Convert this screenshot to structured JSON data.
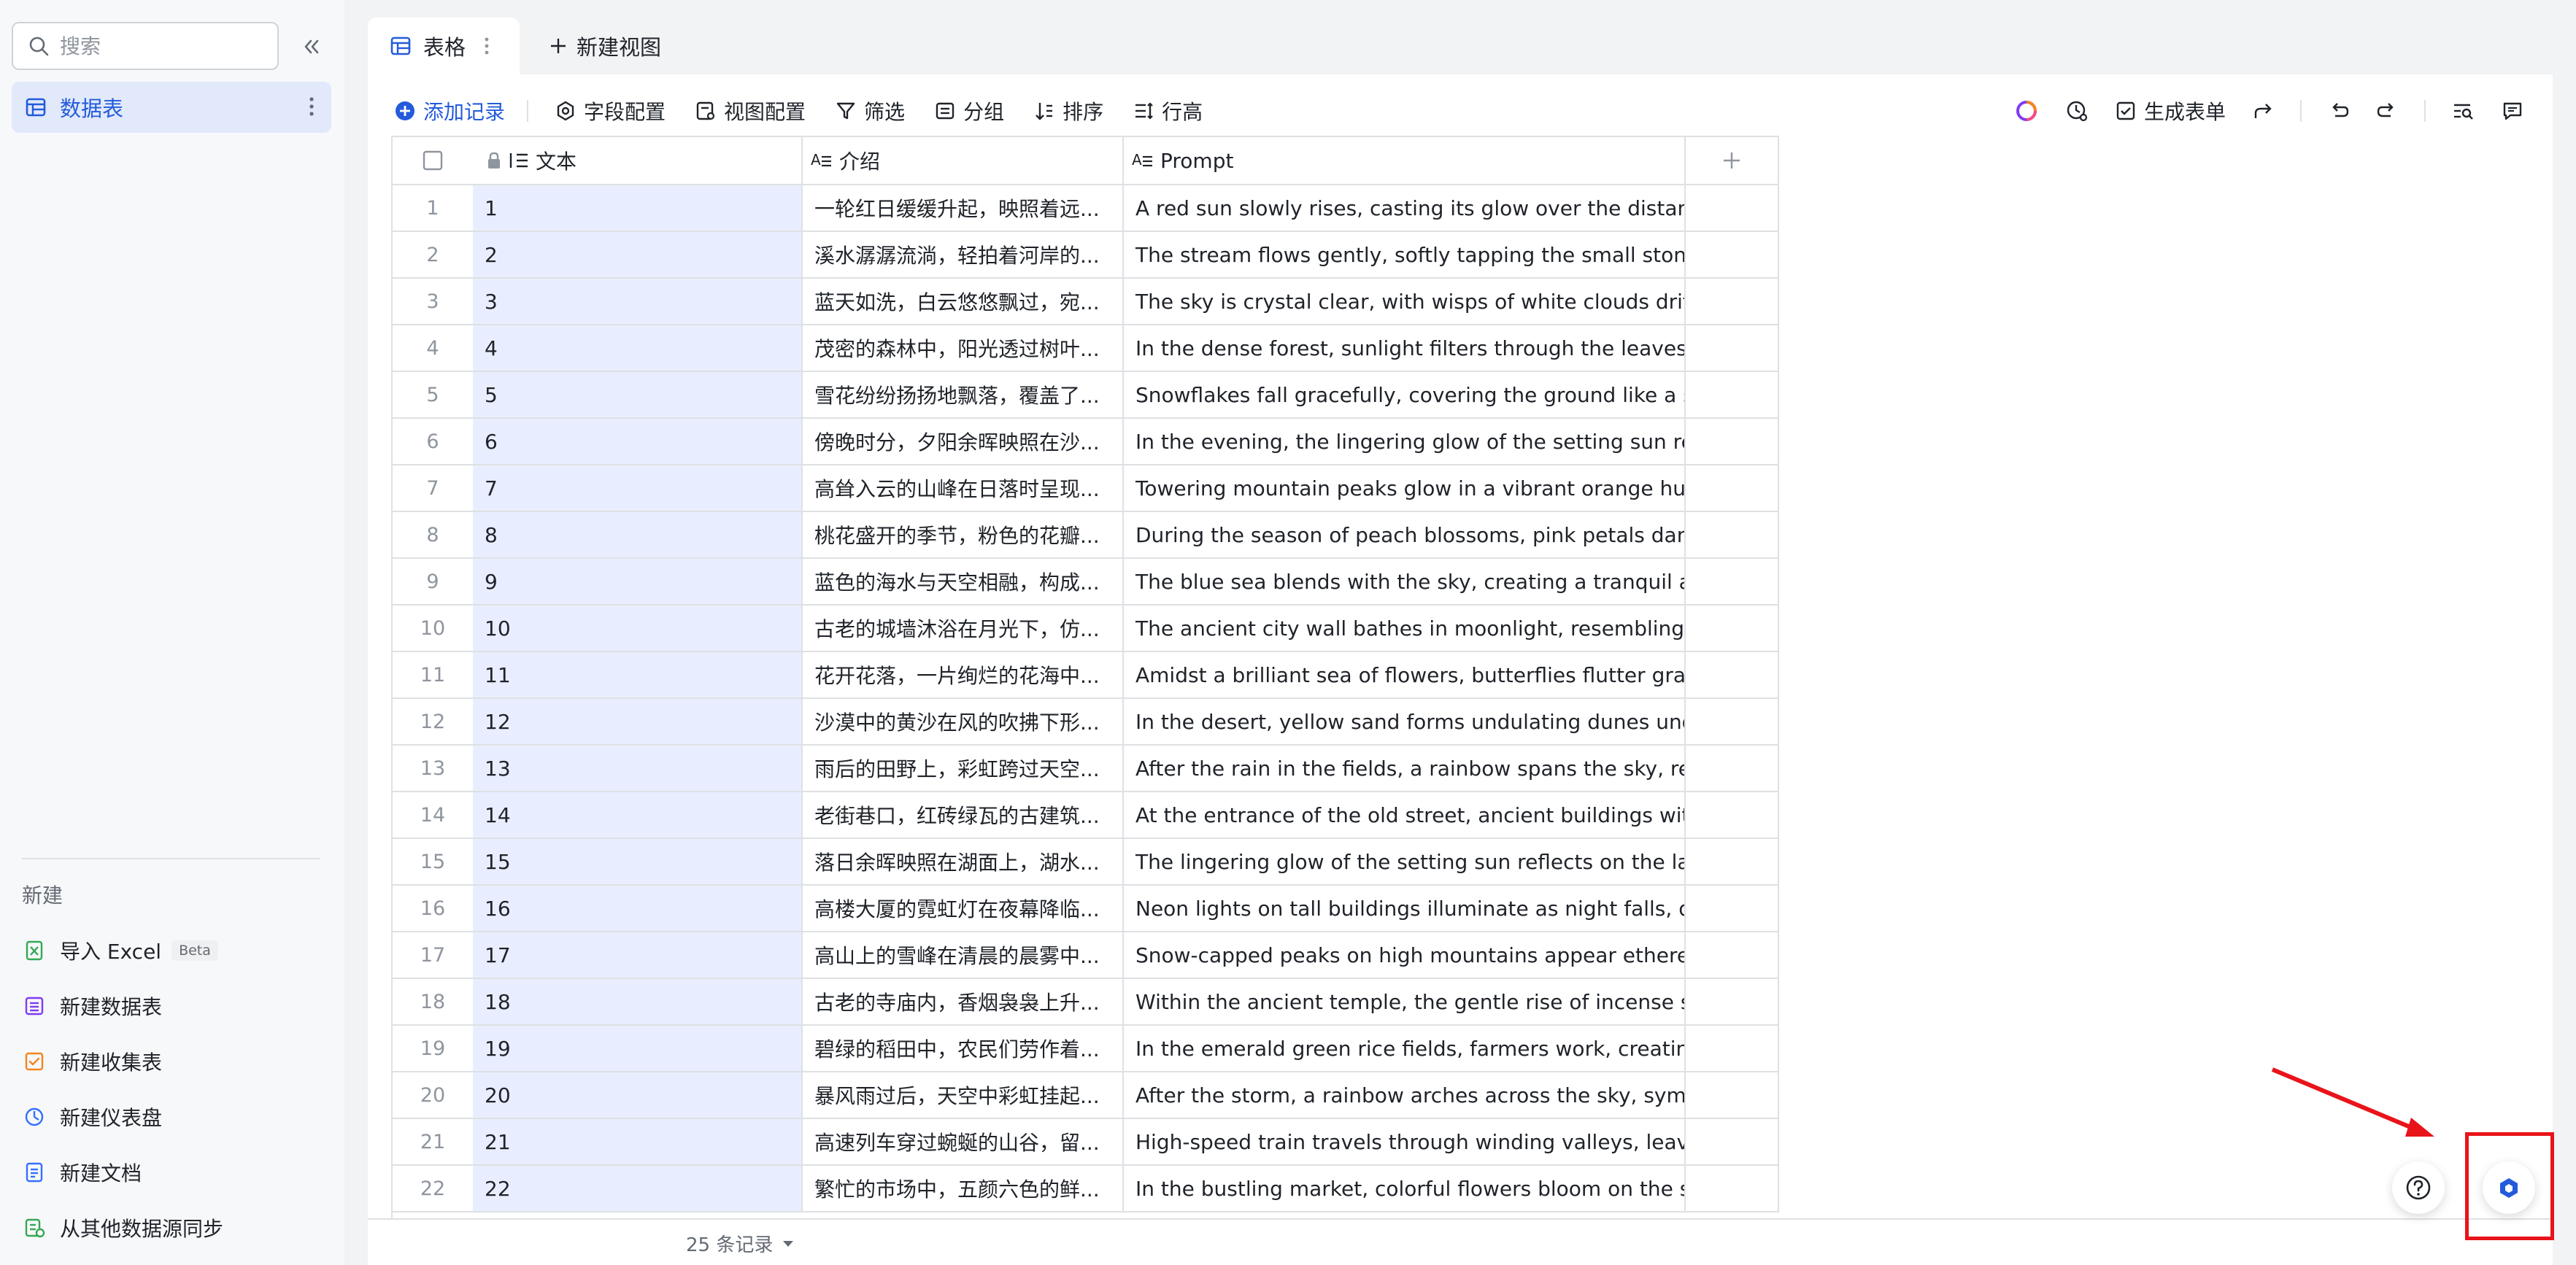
{
  "sidebar": {
    "search_placeholder": "搜索",
    "active_item": "数据表",
    "new_section_title": "新建",
    "new_items": [
      {
        "label": "导入 Excel",
        "badge": "Beta"
      },
      {
        "label": "新建数据表"
      },
      {
        "label": "新建收集表"
      },
      {
        "label": "新建仪表盘"
      },
      {
        "label": "新建文档"
      },
      {
        "label": "从其他数据源同步"
      }
    ]
  },
  "tabs": {
    "active_view": "表格",
    "new_view": "新建视图"
  },
  "toolbar": {
    "add_record": "添加记录",
    "field_config": "字段配置",
    "view_config": "视图配置",
    "filter": "筛选",
    "group": "分组",
    "sort": "排序",
    "row_height": "行高",
    "generate_form": "生成表单"
  },
  "table": {
    "columns": [
      "文本",
      "介绍",
      "Prompt"
    ],
    "rows": [
      {
        "n": "1",
        "text": "1",
        "intro": "一轮红日缓缓升起，映照着远...",
        "prompt": "A red sun slowly rises, casting its glow over the distant ..."
      },
      {
        "n": "2",
        "text": "2",
        "intro": "溪水潺潺流淌，轻拍着河岸的...",
        "prompt": "The stream flows gently, softly tapping the small stones..."
      },
      {
        "n": "3",
        "text": "3",
        "intro": "蓝天如洗，白云悠悠飘过，宛...",
        "prompt": "The sky is crystal clear, with wisps of white clouds drifti..."
      },
      {
        "n": "4",
        "text": "4",
        "intro": "茂密的森林中，阳光透过树叶...",
        "prompt": "In the dense forest, sunlight filters through the leaves, ..."
      },
      {
        "n": "5",
        "text": "5",
        "intro": "雪花纷纷扬扬地飘落，覆盖了...",
        "prompt": "Snowflakes fall gracefully, covering the ground like a sil..."
      },
      {
        "n": "6",
        "text": "6",
        "intro": "傍晚时分，夕阳余晖映照在沙...",
        "prompt": "In the evening, the lingering glow of the setting sun refl..."
      },
      {
        "n": "7",
        "text": "7",
        "intro": "高耸入云的山峰在日落时呈现...",
        "prompt": "Towering mountain peaks glow in a vibrant orange hue ..."
      },
      {
        "n": "8",
        "text": "8",
        "intro": "桃花盛开的季节，粉色的花瓣...",
        "prompt": "During the season of peach blossoms, pink petals danc..."
      },
      {
        "n": "9",
        "text": "9",
        "intro": "蓝色的海水与天空相融，构成...",
        "prompt": "The blue sea blends with the sky, creating a tranquil an..."
      },
      {
        "n": "10",
        "text": "10",
        "intro": "古老的城墙沐浴在月光下，仿...",
        "prompt": "The ancient city wall bathes in moonlight, resembling a ..."
      },
      {
        "n": "11",
        "text": "11",
        "intro": "花开花落，一片绚烂的花海中...",
        "prompt": "Amidst a brilliant sea of flowers, butterflies flutter grace..."
      },
      {
        "n": "12",
        "text": "12",
        "intro": "沙漠中的黄沙在风的吹拂下形...",
        "prompt": "In the desert, yellow sand forms undulating dunes unde..."
      },
      {
        "n": "13",
        "text": "13",
        "intro": "雨后的田野上，彩虹跨过天空...",
        "prompt": "After the rain in the fields, a rainbow spans the sky, res..."
      },
      {
        "n": "14",
        "text": "14",
        "intro": "老街巷口，红砖绿瓦的古建筑...",
        "prompt": "At the entrance of the old street, ancient buildings with ..."
      },
      {
        "n": "15",
        "text": "15",
        "intro": "落日余晖映照在湖面上，湖水...",
        "prompt": "The lingering glow of the setting sun reflects on the lak..."
      },
      {
        "n": "16",
        "text": "16",
        "intro": "高楼大厦的霓虹灯在夜幕降临...",
        "prompt": "Neon lights on tall buildings illuminate as night falls, da..."
      },
      {
        "n": "17",
        "text": "17",
        "intro": "高山上的雪峰在清晨的晨雾中...",
        "prompt": "Snow-capped peaks on high mountains appear etherea..."
      },
      {
        "n": "18",
        "text": "18",
        "intro": "古老的寺庙内，香烟袅袅上升...",
        "prompt": "Within the ancient temple, the gentle rise of incense sm..."
      },
      {
        "n": "19",
        "text": "19",
        "intro": "碧绿的稻田中，农民们劳作着...",
        "prompt": "In the emerald green rice fields, farmers work, creating ..."
      },
      {
        "n": "20",
        "text": "20",
        "intro": "暴风雨过后，天空中彩虹挂起...",
        "prompt": "After the storm, a rainbow arches across the sky, symb..."
      },
      {
        "n": "21",
        "text": "21",
        "intro": "高速列车穿过蜿蜒的山谷，留...",
        "prompt": "High-speed train travels through winding valleys, leavin..."
      },
      {
        "n": "22",
        "text": "22",
        "intro": "繁忙的市场中，五颜六色的鲜...",
        "prompt": "In the bustling market, colorful flowers bloom on the st..."
      }
    ]
  },
  "footer": {
    "record_count": "25 条记录"
  },
  "colors": {
    "accent": "#245bdb",
    "selected_column": "#e8eeff",
    "annotation": "#e8141a"
  }
}
